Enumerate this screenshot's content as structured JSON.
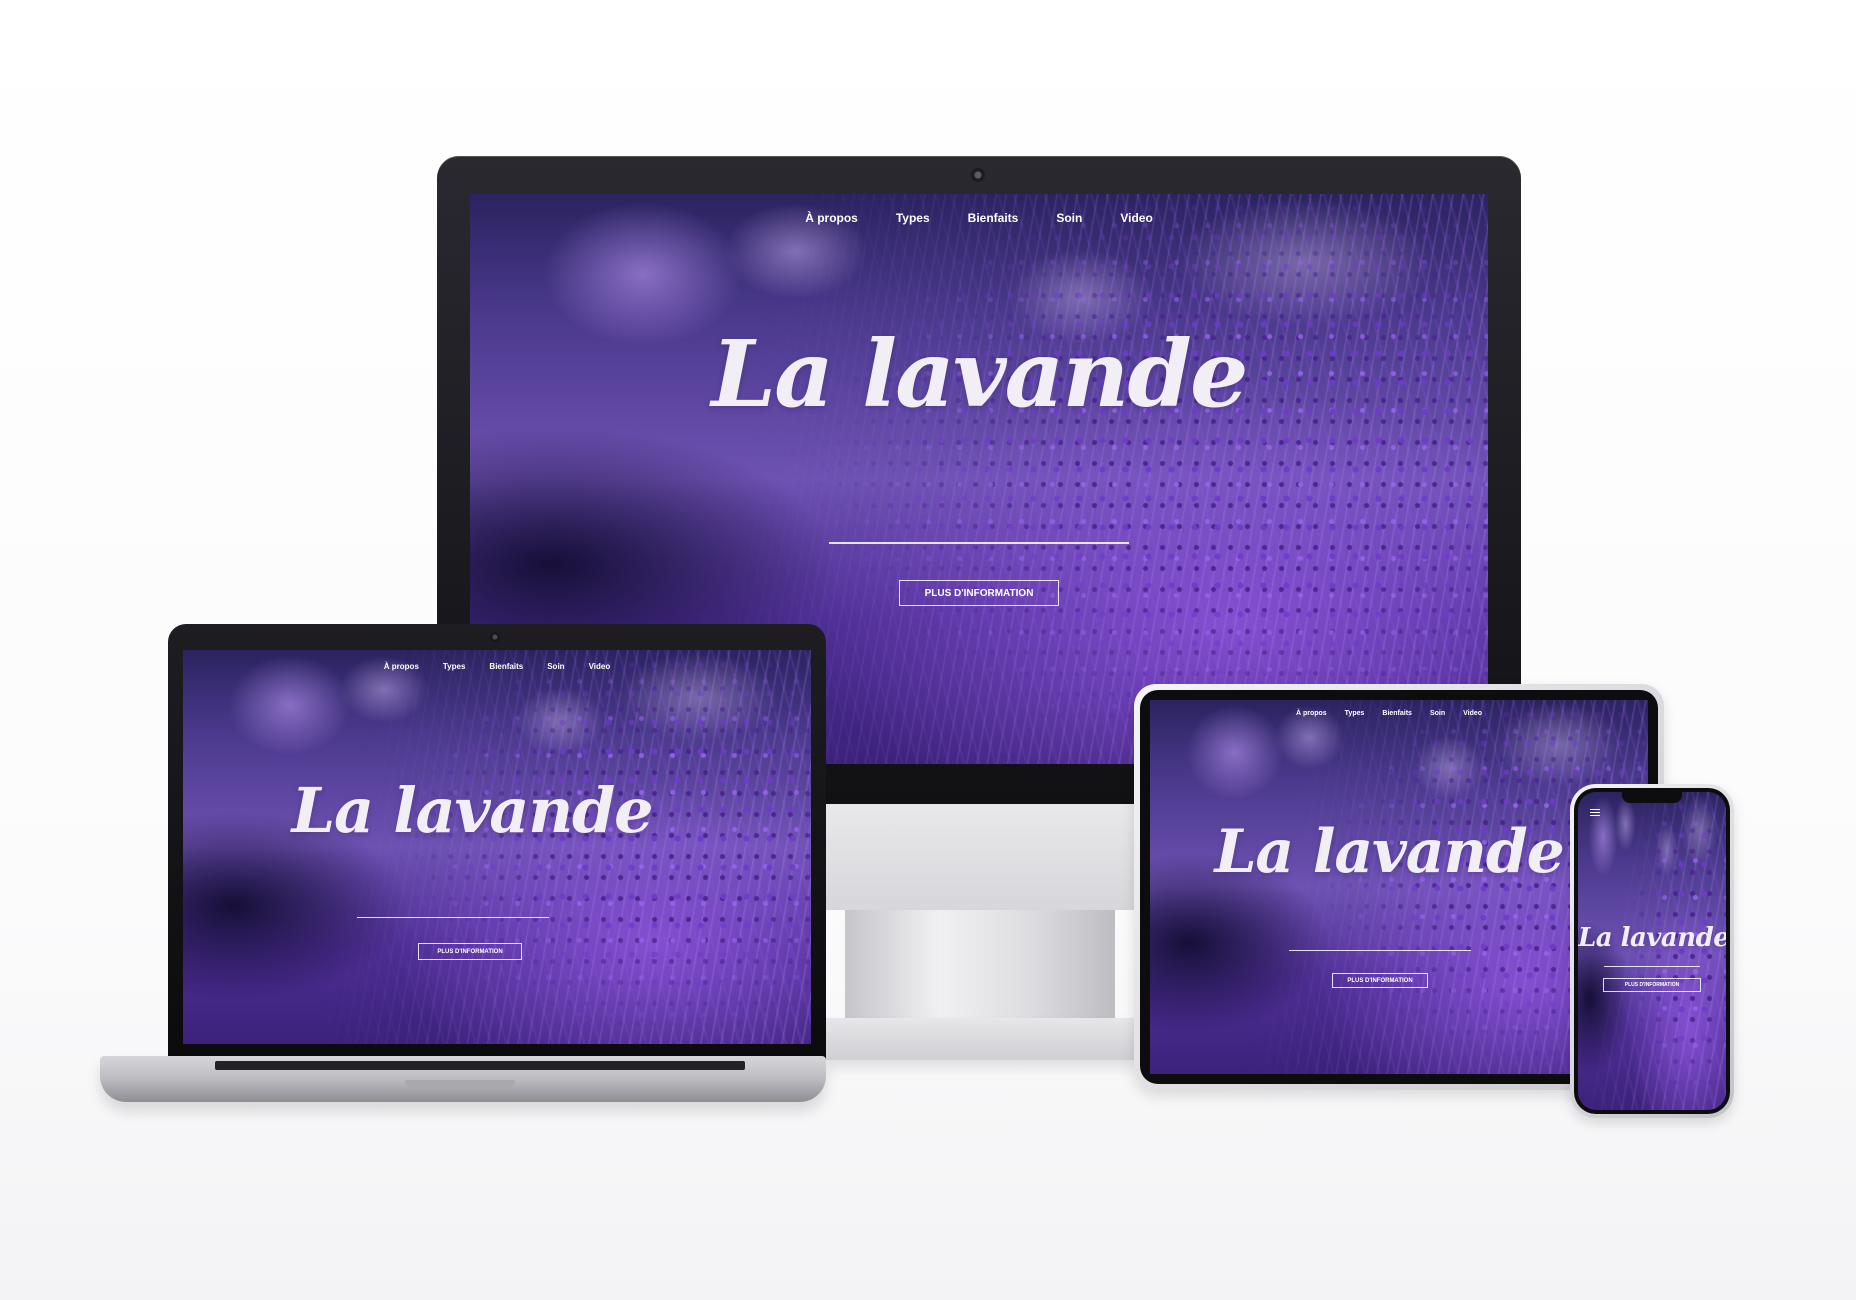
{
  "site": {
    "nav": [
      "À propos",
      "Types",
      "Bienfaits",
      "Soin",
      "Video"
    ],
    "title": "La lavande",
    "cta_label": "PLUS D'INFORMATION",
    "menu_icon": "hamburger-menu-icon"
  },
  "colors": {
    "primary_purple": "#6d52b2",
    "dark_purple": "#2b2360",
    "text_white": "#ffffff"
  }
}
